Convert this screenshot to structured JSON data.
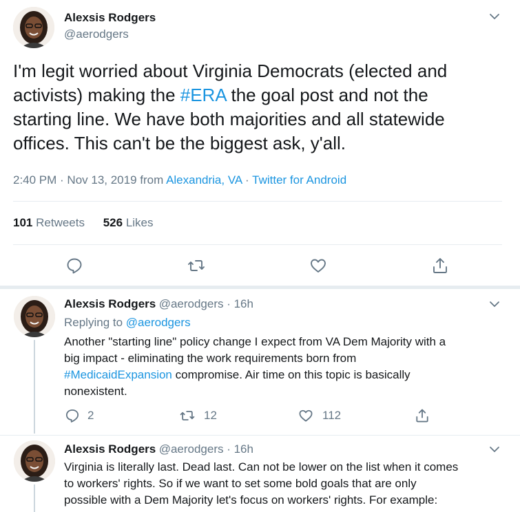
{
  "main_tweet": {
    "author_name": "Alexsis Rodgers",
    "author_handle": "@aerodgers",
    "text_line1": "I'm legit worried about Virginia Democrats (elected and",
    "text_line2_pre": "activists) making the ",
    "text_hashtag": "#ERA",
    "text_line2_post": " the goal post and not the",
    "text_line3": "starting line. We have both majorities and all statewide",
    "text_line4": "offices. This can't be the biggest ask, y'all.",
    "timestamp": "2:40 PM · Nov 13, 2019 from ",
    "location": "Alexandria, VA",
    "separator": " · ",
    "source": "Twitter for Android",
    "retweet_count": "101",
    "retweet_label": "Retweets",
    "like_count": "526",
    "like_label": "Likes"
  },
  "replies": [
    {
      "author_name": "Alexsis Rodgers",
      "author_handle": "@aerodgers · 16h",
      "replying_label": "Replying to ",
      "replying_handle": "@aerodgers",
      "line1": "Another \"starting line\" policy change I expect from VA Dem Majority with a",
      "line2": "big impact - eliminating the work requirements born from",
      "line3_hashtag": "#MedicaidExpansion",
      "line3_post": " compromise. Air time on this topic is basically",
      "line4": "nonexistent.",
      "reply_count": "2",
      "retweet_count": "12",
      "like_count": "112"
    },
    {
      "author_name": "Alexsis Rodgers",
      "author_handle": "@aerodgers · 16h",
      "line1": "Virginia is literally last. Dead last. Can not be lower on the list when it comes",
      "line2": "to workers' rights. So if we want to set some bold goals that are only",
      "line3": "possible with a Dem Majority let's focus on workers' rights. For example:"
    }
  ],
  "colors": {
    "link": "#1b95e0",
    "muted": "#657786",
    "divider": "#e6ecf0",
    "section_bg": "#e6ecf0"
  },
  "icons": [
    "chevron-down-icon",
    "reply-icon",
    "retweet-icon",
    "like-icon",
    "share-icon"
  ]
}
